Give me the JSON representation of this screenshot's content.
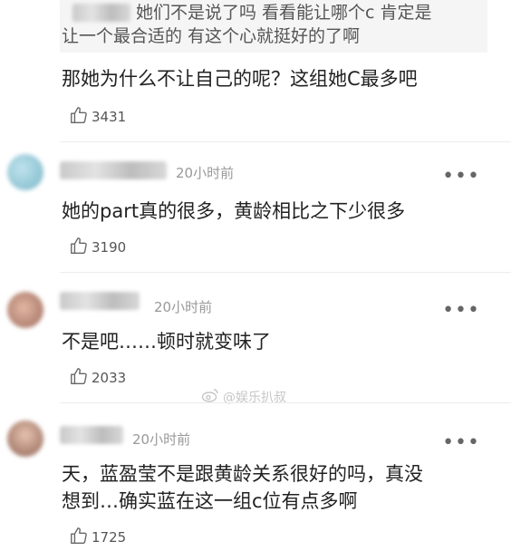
{
  "quoted_reply": {
    "line1": "她们不是说了吗  看看能让哪个c  肯定是",
    "line2": "让一个最合适的   有这个心就挺好的了啊"
  },
  "comments": [
    {
      "text": "那她为什么不让自己的呢？这组她C最多吧",
      "likes": "3431"
    },
    {
      "time": "20小时前",
      "text": "她的part真的很多，黄龄相比之下少很多",
      "likes": "3190",
      "more": "•••",
      "avatar_color": "#8fc7d8"
    },
    {
      "time": "20小时前",
      "text": "不是吧……顿时就变味了",
      "likes": "2033",
      "more": "•••",
      "avatar_color": "#c98f7a"
    },
    {
      "time": "20小时前",
      "line1": "天，蓝盈莹不是跟黄龄关系很好的吗，真没",
      "line2": "想到…确实蓝在这一组c位有点多啊",
      "likes": "1725",
      "more": "•••",
      "avatar_color": "#b98c78"
    }
  ],
  "watermark": {
    "icon": "weibo-icon",
    "text": "@娱乐扒叔"
  }
}
